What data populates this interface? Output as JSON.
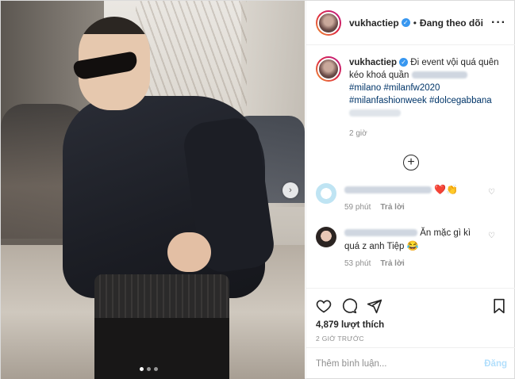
{
  "post": {
    "username": "vukhactiep",
    "follow_status": "Đang theo dõi",
    "more_icon": "more-horizontal-icon",
    "caption": {
      "username": "vukhactiep",
      "text": "Đi event vội quá quên kéo khoá quần",
      "tags": "#milano #milanfw2020 #milanfashionweek #dolcegabbana"
    },
    "caption_time": "2 giờ",
    "load_more_icon": "plus-circle-icon",
    "photo_dots": 3,
    "photo_active_dot": 0
  },
  "comments": [
    {
      "text": "",
      "emoji": "❤️👏",
      "time": "59 phút",
      "reply": "Trả lời"
    },
    {
      "text": "Ăn mặc gì kì quá z anh Tiệp",
      "emoji": "😂",
      "time": "53 phút",
      "reply": "Trả lời"
    }
  ],
  "actions": {
    "likes": "4,879 lượt thích",
    "ago": "2 GIỜ TRƯỚC"
  },
  "add_comment": {
    "placeholder": "Thêm bình luận...",
    "post_label": "Đăng"
  },
  "colors": {
    "verified": "#3897f0",
    "hashtag": "#003569",
    "post_button_disabled": "#b2dffc",
    "meta_gray": "#8e8e8e"
  }
}
